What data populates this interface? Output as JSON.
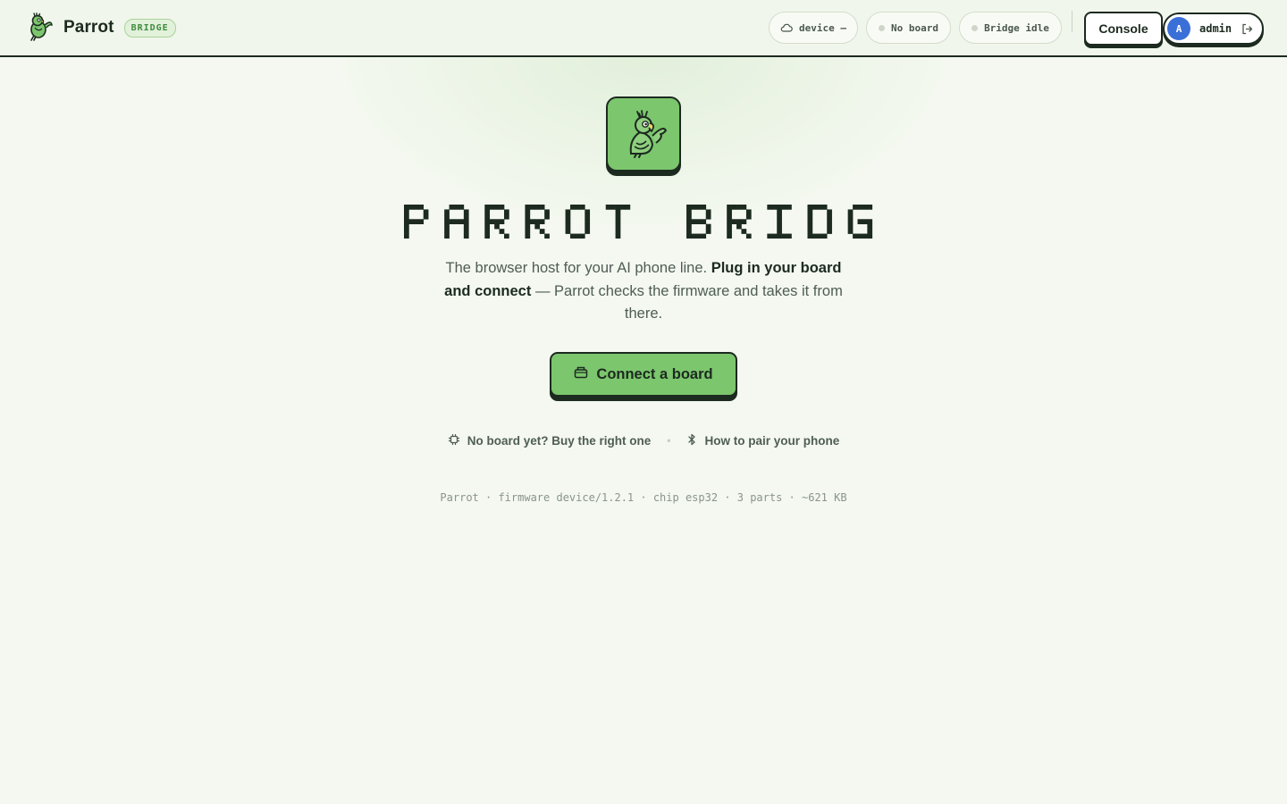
{
  "header": {
    "brand_name": "Parrot",
    "brand_badge": "BRIDGE",
    "device_pill": "device —",
    "board_pill": "No board",
    "bridge_pill": "Bridge idle",
    "console_label": "Console",
    "user": {
      "avatar_initial": "A",
      "name": "admin"
    }
  },
  "hero": {
    "title": "PARROT BRIDGE",
    "tagline_pre": "The browser host for your AI phone line. ",
    "tagline_bold": "Plug in your board and connect",
    "tagline_post": " — Parrot checks the firmware and takes it from there.",
    "connect_label": "Connect a board"
  },
  "links": {
    "buy_board": "No board yet? Buy the right one",
    "separator": "•",
    "pair_phone": "How to pair your phone"
  },
  "footer": {
    "meta": "Parrot · firmware device/1.2.1 · chip esp32 · 3 parts · ~621 KB"
  },
  "colors": {
    "background": "#f4f8f0",
    "ink": "#1c2a1f",
    "brand_green": "#7cc66e",
    "avatar_blue": "#3b6fd8",
    "muted_text": "#4f5d52"
  },
  "icons": {
    "brand": "parrot-icon",
    "device": "cloud-icon",
    "board_status": "status-dot-icon",
    "bridge_status": "status-dot-icon",
    "logout": "logout-icon",
    "connect": "usb-board-icon",
    "buy": "chip-icon",
    "pair": "bluetooth-icon"
  }
}
